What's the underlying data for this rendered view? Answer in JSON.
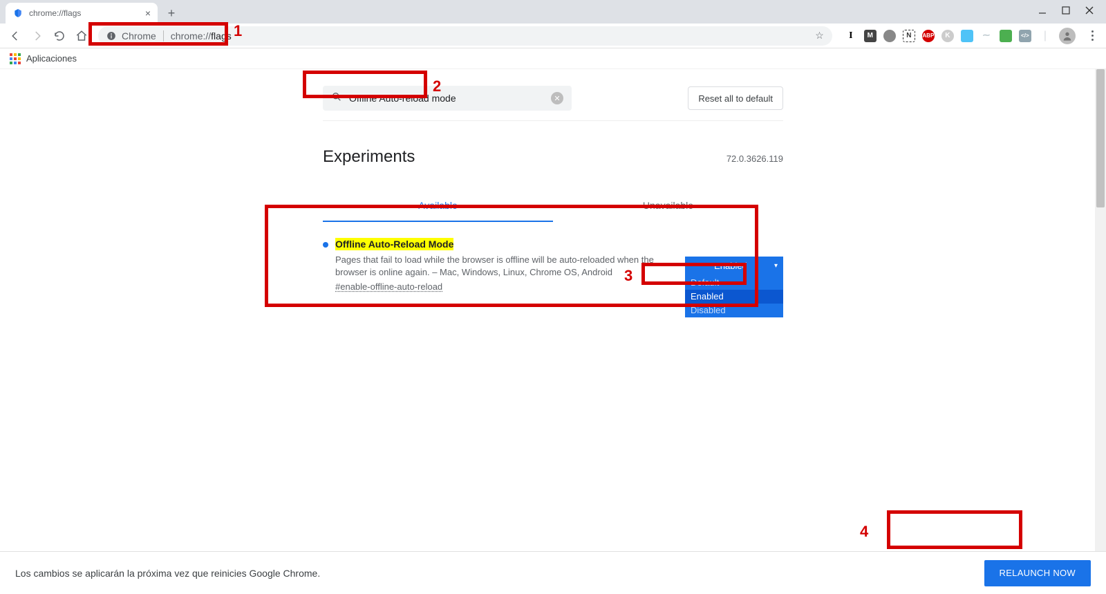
{
  "tab": {
    "title": "chrome://flags"
  },
  "omnibox": {
    "origin_label": "Chrome",
    "url_prefix": "chrome://",
    "url_path": "flags"
  },
  "bookmarks": {
    "apps_label": "Aplicaciones"
  },
  "search": {
    "value": "Offline Auto-reload mode"
  },
  "reset_button": "Reset all to default",
  "page_title": "Experiments",
  "version": "72.0.3626.119",
  "tabs": {
    "available": "Available",
    "unavailable": "Unavailable"
  },
  "flag": {
    "title": "Offline Auto-Reload Mode",
    "description": "Pages that fail to load while the browser is offline will be auto-reloaded when the browser is online again. – Mac, Windows, Linux, Chrome OS, Android",
    "hash": "#enable-offline-auto-reload",
    "selected": "Enabled",
    "options": {
      "default": "Default",
      "enabled": "Enabled",
      "disabled": "Disabled"
    }
  },
  "bottom": {
    "message": "Los cambios se aplicarán la próxima vez que reinicies Google Chrome.",
    "relaunch": "RELAUNCH NOW"
  },
  "annotations": {
    "a1": "1",
    "a2": "2",
    "a3": "3",
    "a4": "4"
  }
}
